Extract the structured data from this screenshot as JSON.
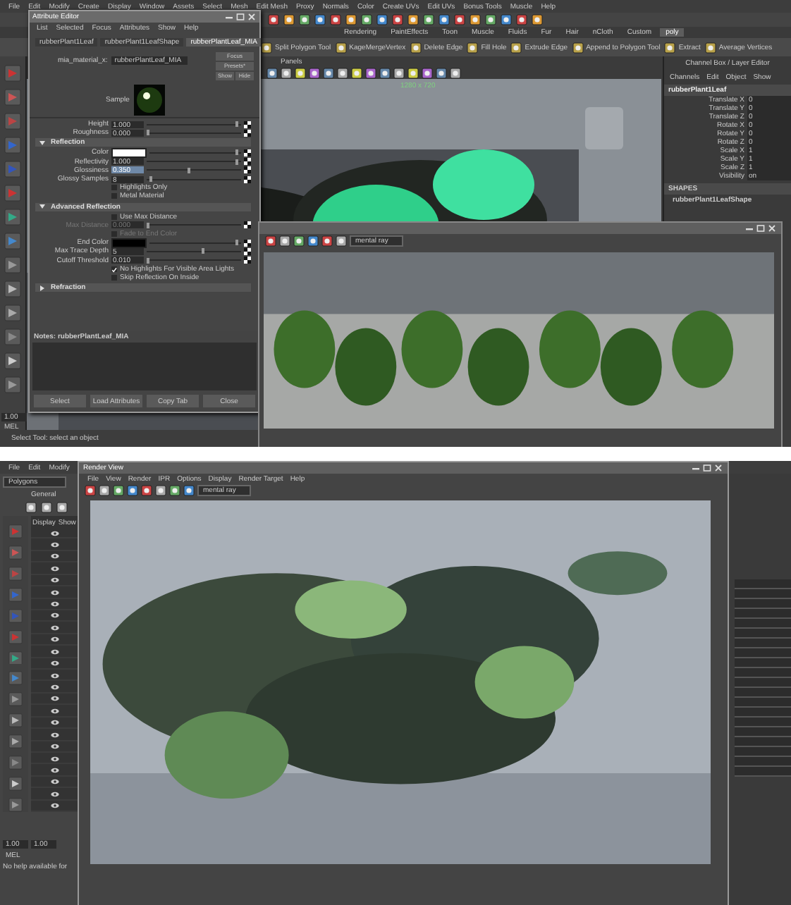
{
  "top": {
    "menu_bar": [
      "File",
      "Edit",
      "Modify",
      "Create",
      "Display",
      "Window",
      "Assets",
      "Select",
      "Mesh",
      "Edit Mesh",
      "Proxy",
      "Normals",
      "Color",
      "Create UVs",
      "Edit UVs",
      "Bonus Tools",
      "Muscle",
      "Help"
    ],
    "shelf_tabs": [
      {
        "label": "Rendering",
        "selected": false
      },
      {
        "label": "PaintEffects",
        "selected": false
      },
      {
        "label": "Toon",
        "selected": false
      },
      {
        "label": "Muscle",
        "selected": false
      },
      {
        "label": "Fluids",
        "selected": false
      },
      {
        "label": "Fur",
        "selected": false
      },
      {
        "label": "Hair",
        "selected": false
      },
      {
        "label": "nCloth",
        "selected": false
      },
      {
        "label": "Custom",
        "selected": false
      },
      {
        "label": "poly",
        "selected": true
      }
    ],
    "shelf_tools": [
      "Split Polygon Tool",
      "KageMergeVertex",
      "Delete Edge",
      "Fill Hole",
      "Extrude Edge",
      "Append to Polygon Tool",
      "Extract",
      "Average Vertices"
    ],
    "viewport": {
      "menus": [
        "Panels"
      ],
      "resolution": "1280 x 720"
    },
    "channel_box": {
      "title": "Channel Box / Layer Editor",
      "menus": [
        "Channels",
        "Edit",
        "Object",
        "Show"
      ],
      "object": "rubberPlant1Leaf",
      "attributes": [
        {
          "name": "Translate X",
          "value": "0"
        },
        {
          "name": "Translate Y",
          "value": "0"
        },
        {
          "name": "Translate Z",
          "value": "0"
        },
        {
          "name": "Rotate X",
          "value": "0"
        },
        {
          "name": "Rotate Y",
          "value": "0"
        },
        {
          "name": "Rotate Z",
          "value": "0"
        },
        {
          "name": "Scale X",
          "value": "1"
        },
        {
          "name": "Scale Y",
          "value": "1"
        },
        {
          "name": "Scale Z",
          "value": "1"
        },
        {
          "name": "Visibility",
          "value": "on"
        }
      ],
      "shapes_header": "SHAPES",
      "shape": "rubberPlant1LeafShape"
    },
    "attribute_editor": {
      "title": "Attribute Editor",
      "menus": [
        "List",
        "Selected",
        "Focus",
        "Attributes",
        "Show",
        "Help"
      ],
      "tabs": [
        {
          "label": "rubberPlant1Leaf",
          "selected": false
        },
        {
          "label": "rubberPlant1LeafShape",
          "selected": false
        },
        {
          "label": "rubberPlantLeaf_MIA",
          "selected": true
        }
      ],
      "type_label": "mia_material_x:",
      "node_name": "rubberPlantLeaf_MIA",
      "buttons": [
        "Focus",
        "Presets*",
        "Show",
        "Hide"
      ],
      "sample_label": "Sample",
      "rows": [
        {
          "kind": "slider",
          "label": "Height",
          "value": "1.000",
          "level": 0.95,
          "disabled": false,
          "selected": false
        },
        {
          "kind": "slider",
          "label": "Roughness",
          "value": "0.000",
          "level": 0.02,
          "disabled": false,
          "selected": false
        },
        {
          "kind": "section",
          "label": "Reflection",
          "expanded": true
        },
        {
          "kind": "color",
          "label": "Color",
          "color": "#ffffff",
          "level": 0.95
        },
        {
          "kind": "slider",
          "label": "Reflectivity",
          "value": "1.000",
          "level": 0.95,
          "disabled": false,
          "selected": false
        },
        {
          "kind": "slider",
          "label": "Glossiness",
          "value": "0.350",
          "level": 0.45,
          "disabled": false,
          "selected": true
        },
        {
          "kind": "slider",
          "label": "Glossy Samples",
          "value": "8",
          "level": 0.05,
          "disabled": false,
          "selected": false
        },
        {
          "kind": "checkbox",
          "label": "Highlights Only",
          "checked": false,
          "disabled": false
        },
        {
          "kind": "checkbox",
          "label": "Metal Material",
          "checked": false,
          "disabled": false
        },
        {
          "kind": "section",
          "label": "Advanced Reflection",
          "expanded": true
        },
        {
          "kind": "checkbox",
          "label": "Use Max Distance",
          "checked": false,
          "disabled": false
        },
        {
          "kind": "slider",
          "label": "Max Distance",
          "value": "0.000",
          "level": 0.02,
          "disabled": true,
          "selected": false
        },
        {
          "kind": "checkbox",
          "label": "Fade to End Color",
          "checked": false,
          "disabled": true
        },
        {
          "kind": "color",
          "label": "End Color",
          "color": "#000000",
          "level": 0.95
        },
        {
          "kind": "slider",
          "label": "Max Trace Depth",
          "value": "5",
          "level": 0.6,
          "disabled": false,
          "selected": false
        },
        {
          "kind": "slider",
          "label": "Cutoff Threshold",
          "value": "0.010",
          "level": 0.02,
          "disabled": false,
          "selected": false
        },
        {
          "kind": "checkbox",
          "label": "No Highlights For Visible Area Lights",
          "checked": true,
          "disabled": false
        },
        {
          "kind": "checkbox",
          "label": "Skip Reflection On Inside",
          "checked": false,
          "disabled": false
        },
        {
          "kind": "section",
          "label": "Refraction",
          "expanded": false
        }
      ],
      "notes": "Notes:  rubberPlantLeaf_MIA",
      "footer_buttons": [
        "Select",
        "Load Attributes",
        "Copy Tab",
        "Close"
      ]
    },
    "render_view": {
      "renderer": "mental ray"
    },
    "status": {
      "value": "1.00",
      "command": "MEL",
      "help": "Select Tool: select an object"
    }
  },
  "bottom": {
    "menu_bar": [
      "File",
      "Edit",
      "Modify"
    ],
    "mode": "Polygons",
    "shelf_tabs": [
      "General"
    ],
    "layer_tabs": [
      "Display",
      "Show"
    ],
    "render_view": {
      "title": "Render View",
      "menus": [
        "File",
        "View",
        "Render",
        "IPR",
        "Options",
        "Display",
        "Render Target",
        "Help"
      ],
      "renderer": "mental ray"
    },
    "fields": [
      "1.00",
      "1.00"
    ],
    "command": "MEL",
    "help": "No help available for"
  }
}
